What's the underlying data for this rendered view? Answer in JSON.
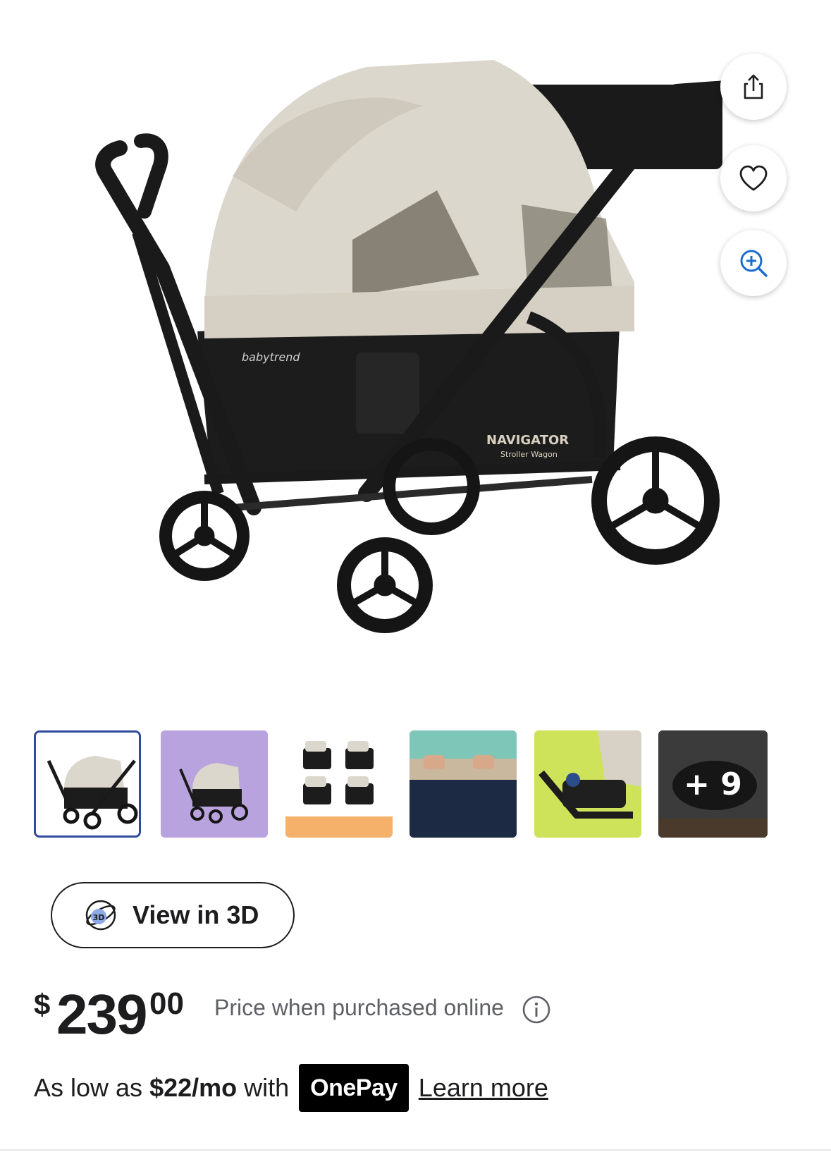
{
  "product_image": {
    "brand_lettering": [
      "babytrend",
      "babytrend",
      "babytrend"
    ],
    "logo_lettering": "NAVIGATOR",
    "logo_sub_lettering": "Stroller Wagon"
  },
  "actions": {
    "share_icon": "share-icon",
    "favorite_icon": "heart-icon",
    "zoom_icon": "zoom-in-icon"
  },
  "gallery": {
    "selected_index": 0,
    "thumbnails": [
      "stroller wagon",
      "stroller wagon on purple",
      "four wagon configurations",
      "wagon interior",
      "stroller basket",
      "more"
    ],
    "more_label": "+ 9"
  },
  "view3d": {
    "label": "View in 3D",
    "icon": "3d-icon",
    "icon_text": "3D"
  },
  "price": {
    "currency": "$",
    "whole": "239",
    "cents": "00",
    "note": "Price when purchased online"
  },
  "installment": {
    "prefix": "As low as",
    "amount": "$22/mo",
    "with": "with",
    "provider": "OnePay",
    "link": "Learn more"
  },
  "colors": {
    "accent_blue": "#2e4a9e",
    "zoom_blue": "#1a6dd0",
    "canopy": "#dcd7cc",
    "basket": "#1c1c1c"
  }
}
